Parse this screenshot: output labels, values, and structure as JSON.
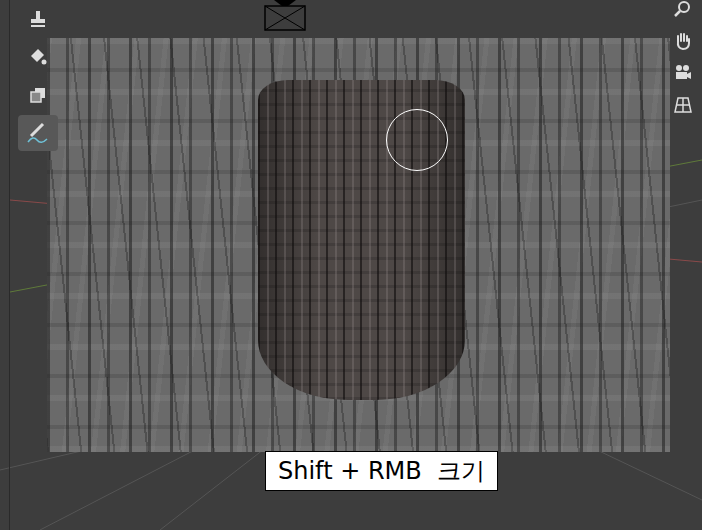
{
  "toolbar": {
    "tools": [
      {
        "selected": false
      },
      {
        "selected": false
      },
      {
        "selected": false
      },
      {
        "selected": true
      }
    ]
  },
  "caption": {
    "text": "Shift + RMB  크기"
  }
}
